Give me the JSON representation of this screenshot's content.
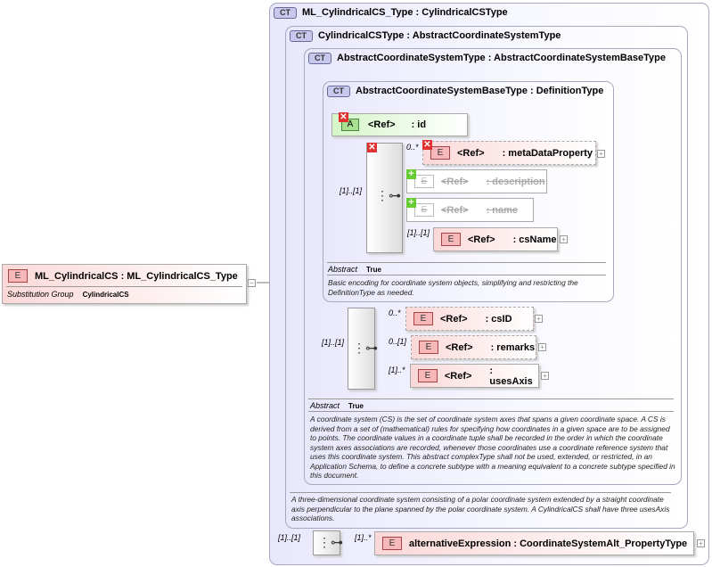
{
  "root": {
    "badge": "E",
    "name": "ML_CylindricalCS : ML_CylindricalCS_Type",
    "subst_label": "Substitution Group",
    "subst_value": "CylindricalCS"
  },
  "ct1": {
    "badge": "CT",
    "title": "ML_CylindricalCS_Type : CylindricalCSType"
  },
  "ct2": {
    "badge": "CT",
    "title": "CylindricalCSType : AbstractCoordinateSystemType",
    "desc": "A three-dimensional coordinate system consisting of a polar coordinate system extended by a straight coordinate axis perpendicular to the plane spanned by the polar coordinate system. A CylindricalCS shall have three usesAxis associations."
  },
  "ct3": {
    "badge": "CT",
    "title": "AbstractCoordinateSystemType : AbstractCoordinateSystemBaseType",
    "abstract_label": "Abstract",
    "abstract_value": "True",
    "desc": "A coordinate system (CS) is the set of coordinate system axes that spans a given coordinate space. A CS is derived from a set of (mathematical) rules for specifying how coordinates in a given space are to be assigned to points. The coordinate values in a coordinate tuple shall be recorded in the order in which the coordinate system axes associations are recorded, whenever those coordinates use a coordinate reference system that uses this coordinate system. This abstract complexType shall not be used, extended, or restricted, in an Application Schema, to define a concrete subtype with a meaning equivalent to a concrete subtype specified in this document."
  },
  "ct4": {
    "badge": "CT",
    "title": "AbstractCoordinateSystemBaseType : DefinitionType",
    "abstract_label": "Abstract",
    "abstract_value": "True",
    "desc": "Basic encoding for coordinate system objects, simplifying and restricting the DefinitionType as needed."
  },
  "attr_id": {
    "badge": "A",
    "ref": "<Ref>",
    "name": ": id"
  },
  "elements": [
    {
      "badge": "E",
      "ref": "<Ref>",
      "name": ": metaDataProperty",
      "card": "0..*"
    },
    {
      "badge": "E",
      "ref": "<Ref>",
      "name": ": description"
    },
    {
      "badge": "E",
      "ref": "<Ref>",
      "name": ": name"
    },
    {
      "badge": "E",
      "ref": "<Ref>",
      "name": ": csName",
      "card": "[1]..[1]"
    },
    {
      "badge": "E",
      "ref": "<Ref>",
      "name": ": csID",
      "card": "0..*"
    },
    {
      "badge": "E",
      "ref": "<Ref>",
      "name": ": remarks",
      "card": "0..[1]"
    },
    {
      "badge": "E",
      "ref": "<Ref>",
      "name": ": usesAxis",
      "card": "[1]..*"
    },
    {
      "badge": "E",
      "name": "alternativeExpression : CoordinateSystemAlt_PropertyType",
      "card": "[1]..*"
    }
  ],
  "seq_cards": {
    "seq1": "[1]..[1]",
    "seq2": "[1]..[1]",
    "seq3": "[1]..[1]"
  }
}
